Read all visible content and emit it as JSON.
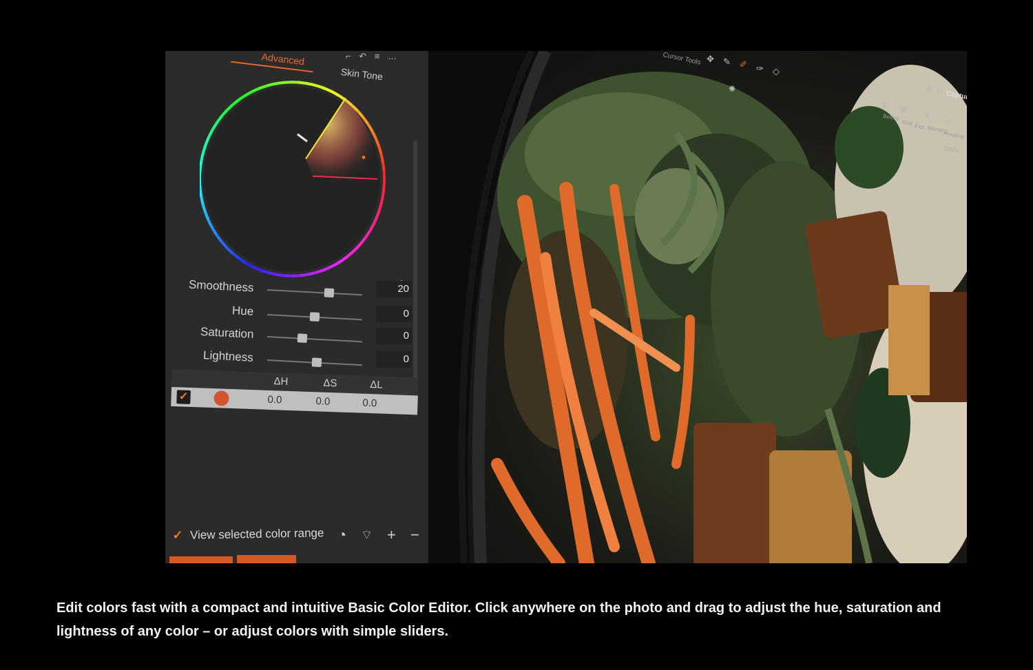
{
  "panel": {
    "tabs": {
      "advanced": "Advanced",
      "skin_tone": "Skin Tone"
    },
    "header_icons": "⌐ ↶ ≡ …",
    "sliders": [
      {
        "label": "Smoothness",
        "value": "20",
        "level": 0.65
      },
      {
        "label": "Hue",
        "value": "0",
        "level": 0.5
      },
      {
        "label": "Saturation",
        "value": "0",
        "level": 0.37
      },
      {
        "label": "Lightness",
        "value": "0",
        "level": 0.52
      }
    ],
    "table": {
      "headers": [
        "ΔH",
        "ΔS",
        "ΔL"
      ],
      "row": {
        "checked": "✓",
        "swatch_color": "#d2562b",
        "dh": "0.0",
        "ds": "0.0",
        "dl": "0.0"
      }
    },
    "view_range": {
      "checked": "✓",
      "label": "View selected color range"
    },
    "accent_color": "#e86a2b"
  },
  "viewer": {
    "cursor_tools_label": "Cursor Tools",
    "toolbar_buttons": [
      "Before",
      "Grid",
      "Exp. Warning",
      "Proofing"
    ],
    "zoom": "100%",
    "app_label": "Capture"
  },
  "caption": "Edit colors fast with a compact and intuitive Basic Color Editor. Click anywhere on the photo and drag to adjust the hue, saturation and lightness of any color – or adjust colors with simple sliders."
}
